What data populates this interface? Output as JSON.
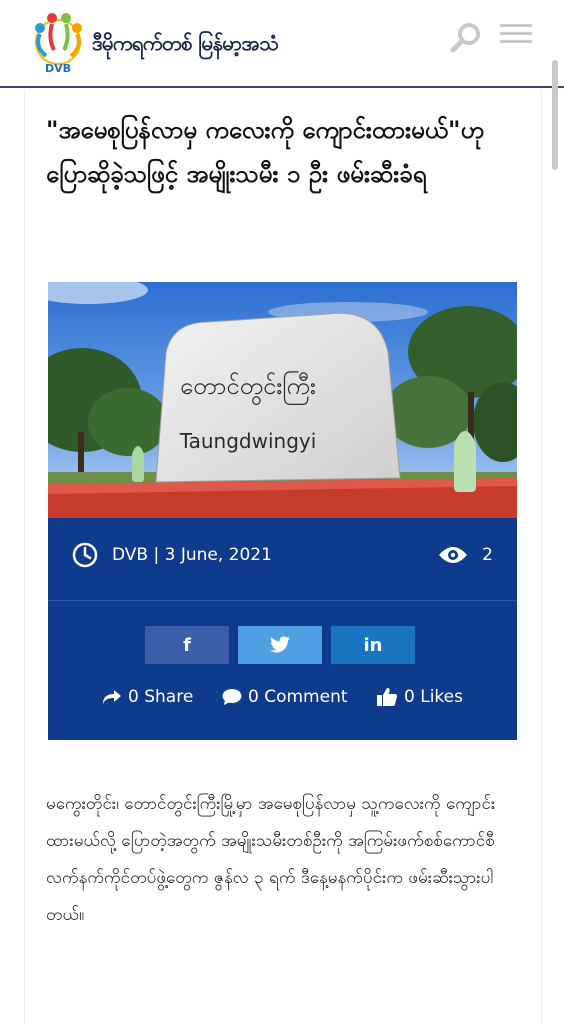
{
  "header": {
    "brand_name": "ဒီမိုကရက်တစ် မြန်မာ့အသံ",
    "logo_text": "DVB",
    "icons": [
      "dvb-logo",
      "search-icon",
      "hamburger-menu-icon"
    ]
  },
  "article": {
    "title": "\"အမေစုပြန်လာမှ ကလေးကို ကျောင်းထားမယ်\"ဟုပြောဆိုခဲ့သဖြင့် အမျိုးသမီး ၁ ဦး ဖမ်းဆီးခံရ",
    "photo": {
      "sign_burmese": "တောင်တွင်းကြီး",
      "sign_english": "Taungdwingyi"
    },
    "meta": {
      "byline": "DVB | 3 June, 2021",
      "views": "2"
    },
    "share_buttons": {
      "facebook": "f",
      "linkedin": "in"
    },
    "stats": {
      "shares": "0 Share",
      "comments": "0 Comment",
      "likes": "0 Likes"
    },
    "body": "မကွေးတိုင်း၊ တောင်တွင်းကြီးမြို့မှာ အမေစုပြန်လာမှ သူ့ကလေးကို ကျောင်းထားမယ်လို့ ပြောတဲ့အတွက် အမျိုးသမီးတစ်ဦးကို အကြမ်းဖက်စစ်ကောင်စီလက်နက်ကိုင်တပ်ဖွဲ့တွေက ဇွန်လ ၃ ရက် ဒီနေ့မနက်ပိုင်းက ဖမ်းဆီးသွားပါတယ်။"
  },
  "colors": {
    "meta_panel": "#0f3b8c",
    "facebook": "#3b5ea8",
    "twitter": "#4fa0e3",
    "linkedin": "#1a74c0",
    "brand": "#16244f"
  }
}
